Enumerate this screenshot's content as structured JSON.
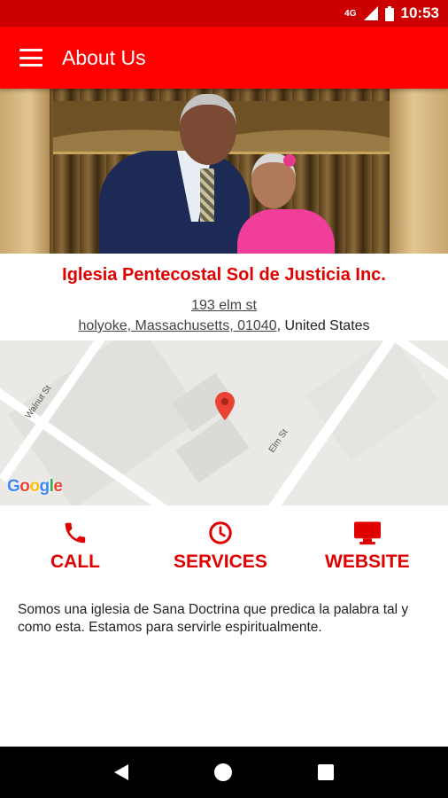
{
  "status_bar": {
    "network": "4G",
    "time": "10:53"
  },
  "app_bar": {
    "title": "About Us"
  },
  "church": {
    "name": "Iglesia Pentecostal Sol de Justicia Inc.",
    "address_line1": "193 elm st",
    "address_line2_link": "holyoke, Massachusetts, 01040",
    "address_line2_country": ", United States"
  },
  "map": {
    "street_labels": [
      "Walnut St",
      "Elm St"
    ],
    "attribution": "Google",
    "attribution_colors": [
      "#4285f4",
      "#ea4335",
      "#fbbc05",
      "#4285f4",
      "#34a853",
      "#ea4335"
    ]
  },
  "actions": [
    {
      "label": "CALL",
      "icon": "phone-icon"
    },
    {
      "label": "SERVICES",
      "icon": "clock-icon"
    },
    {
      "label": "WEBSITE",
      "icon": "monitor-icon"
    }
  ],
  "description": "Somos una iglesia de Sana Doctrina que predica la palabra tal y como esta. Estamos para servirle espiritualmente.",
  "colors": {
    "accent": "#ff0000",
    "status_bar": "#cc0000",
    "action_red": "#e00000"
  }
}
